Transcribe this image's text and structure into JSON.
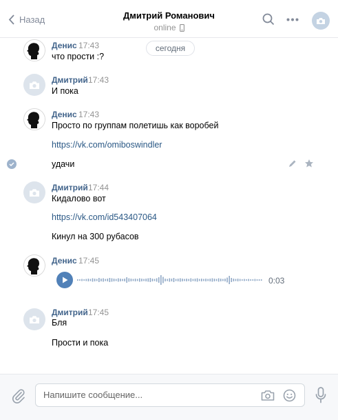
{
  "header": {
    "back_label": "Назад",
    "title": "Дмитрий Романович",
    "status": "online"
  },
  "chat": {
    "date_label": "сегодня",
    "messages": [
      {
        "author": "Денис",
        "time": "17:43",
        "lines": [
          "что прости :?"
        ]
      },
      {
        "author": "Дмитрий",
        "time": "17:43",
        "lines": [
          "И пока"
        ]
      },
      {
        "author": "Денис",
        "time": "17:43",
        "lines": [
          "Просто по группам полетишь как воробей",
          "https://vk.com/omiboswindler",
          "удачи"
        ]
      },
      {
        "author": "Дмитрий",
        "time": "17:44",
        "lines": [
          "Кидалово вот",
          "https://vk.com/id543407064",
          "Кинул на 300 рубасов"
        ]
      },
      {
        "author": "Денис",
        "time": "17:45",
        "audio_duration": "0:03"
      },
      {
        "author": "Дмитрий",
        "time": "17:45",
        "lines": [
          "Бля",
          "Прости и пока"
        ]
      }
    ]
  },
  "composer": {
    "placeholder": "Напишите сообщение..."
  },
  "colors": {
    "link": "#2a5885",
    "author": "#42648b",
    "accent": "#5181b8"
  }
}
